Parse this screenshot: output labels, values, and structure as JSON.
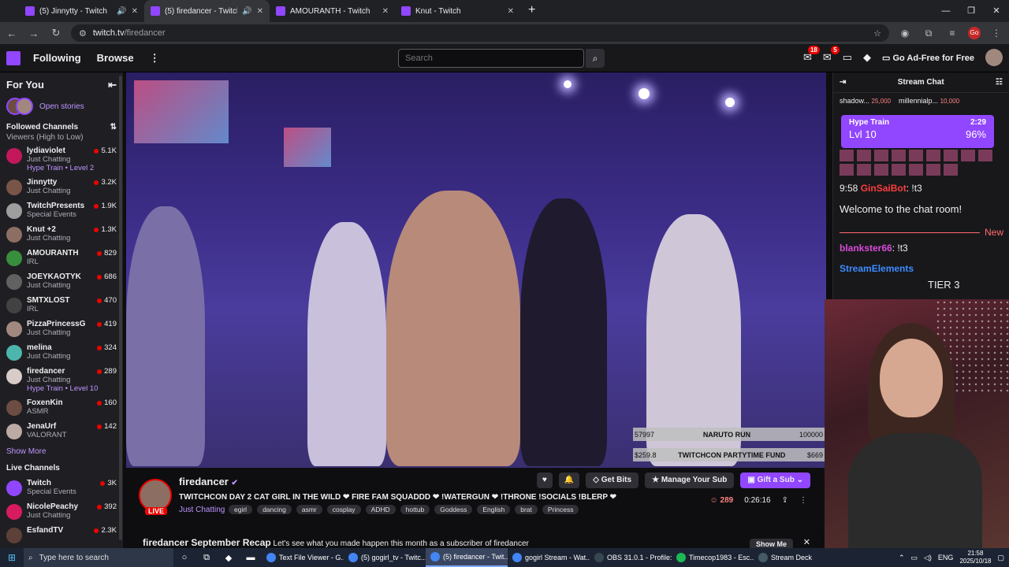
{
  "browser": {
    "tabs": [
      {
        "label": "(5) Jinnytty - Twitch",
        "active": false,
        "audio": true
      },
      {
        "label": "(5) firedancer - Twitch",
        "active": true,
        "audio": true
      },
      {
        "label": "AMOURANTH - Twitch",
        "active": false,
        "audio": false
      },
      {
        "label": "Knut - Twitch",
        "active": false,
        "audio": false
      }
    ],
    "url_host": "twitch.tv",
    "url_path": "/firedancer",
    "profile_initials": "Go"
  },
  "topbar": {
    "following": "Following",
    "browse": "Browse",
    "search_placeholder": "Search",
    "inbox_count": "18",
    "whispers_count": "5",
    "ad_free": "Go Ad-Free for Free"
  },
  "sidebar": {
    "for_you": "For You",
    "open_stories": "Open stories",
    "followed_title": "Followed Channels",
    "followed_sort": "Viewers (High to Low)",
    "channels": [
      {
        "name": "lydiaviolet",
        "category": "Just Chatting",
        "viewers": "5.1K",
        "hype": "Hype Train • Level 2",
        "color": "#c2185b"
      },
      {
        "name": "Jinnytty",
        "category": "Just Chatting",
        "viewers": "3.2K",
        "hype": "",
        "color": "#795548"
      },
      {
        "name": "TwitchPresents",
        "category": "Special Events",
        "viewers": "1.9K",
        "hype": "",
        "color": "#9e9e9e"
      },
      {
        "name": "Knut +2",
        "category": "Just Chatting",
        "viewers": "1.3K",
        "hype": "",
        "color": "#8d6e63"
      },
      {
        "name": "AMOURANTH",
        "category": "IRL",
        "viewers": "829",
        "hype": "",
        "color": "#388e3c"
      },
      {
        "name": "JOEYKAOTYK",
        "category": "Just Chatting",
        "viewers": "686",
        "hype": "",
        "color": "#616161"
      },
      {
        "name": "SMTXLOST",
        "category": "IRL",
        "viewers": "470",
        "hype": "",
        "color": "#424242"
      },
      {
        "name": "PizzaPrincessG",
        "category": "Just Chatting",
        "viewers": "419",
        "hype": "",
        "color": "#a1887f"
      },
      {
        "name": "melina",
        "category": "Just Chatting",
        "viewers": "324",
        "hype": "",
        "color": "#4db6ac"
      },
      {
        "name": "firedancer",
        "category": "Just Chatting",
        "viewers": "289",
        "hype": "Hype Train • Level 10",
        "color": "#d7ccc8"
      },
      {
        "name": "FoxenKin",
        "category": "ASMR",
        "viewers": "160",
        "hype": "",
        "color": "#6d4c41"
      },
      {
        "name": "JenaUrf",
        "category": "VALORANT",
        "viewers": "142",
        "hype": "",
        "color": "#bcaaa4"
      }
    ],
    "show_more": "Show More",
    "live_title": "Live Channels",
    "live_channels": [
      {
        "name": "Twitch",
        "category": "Special Events",
        "viewers": "3K",
        "color": "#9146ff"
      },
      {
        "name": "NicolePeachy",
        "category": "Just Chatting",
        "viewers": "392",
        "color": "#d81b60"
      },
      {
        "name": "EsfandTV",
        "category": "",
        "viewers": "2.3K",
        "color": "#5d4037"
      }
    ]
  },
  "video": {
    "goal1_left": "57997",
    "goal1_mid": "NARUTO RUN",
    "goal1_right": "100000",
    "goal2_left": "$259.8",
    "goal2_mid": "TWITCHCON PARTYTIME FUND",
    "goal2_right": "$669"
  },
  "stream": {
    "name": "firedancer",
    "live": "LIVE",
    "title": "TWITCHCON DAY 2 CAT GIRL IN THE WILD ❤ FIRE FAM SQUADDD ❤ !WATERGUN ❤ !THRONE !SOCIALS !BLERP ❤",
    "category": "Just Chatting",
    "tags": [
      "egirl",
      "dancing",
      "asmr",
      "cosplay",
      "ADHD",
      "hottub",
      "Goddess",
      "English",
      "brat",
      "Princess"
    ],
    "get_bits": "Get Bits",
    "manage_sub": "Manage Your Sub",
    "gift_sub": "Gift a Sub",
    "viewers": "289",
    "uptime": "0:26:16",
    "recap_title": "firedancer September Recap",
    "recap_text": "Let's see what you made happen this month as a subscriber of firedancer",
    "show_me": "Show Me"
  },
  "chat": {
    "title": "Stream Chat",
    "pinned": [
      {
        "user": "shadow...",
        "amount": "25,000"
      },
      {
        "user": "millennialp...",
        "amount": "10,000"
      }
    ],
    "hype_label": "Hype Train",
    "hype_time": "2:29",
    "hype_level": "Lvl 10",
    "hype_pct": "96%",
    "msg1_time": "9:58",
    "msg1_user": "GinSaiBot",
    "msg1_text": ": !t3",
    "welcome": "Welcome to the chat room!",
    "new_label": "New",
    "msg2_user": "blankster66",
    "msg2_text": ": !t3",
    "msg3_user": "StreamElements",
    "msg3_text": "TIER 3"
  },
  "taskbar": {
    "search_placeholder": "Type here to search",
    "apps": [
      {
        "label": "Text File Viewer - G...",
        "active": false,
        "color": "#4285f4"
      },
      {
        "label": "(5) gogirl_tv - Twitc...",
        "active": false,
        "color": "#4285f4"
      },
      {
        "label": "(5) firedancer - Twit...",
        "active": true,
        "color": "#4285f4"
      },
      {
        "label": "gogirl Stream - Wat...",
        "active": false,
        "color": "#4285f4"
      },
      {
        "label": "OBS 31.0.1 - Profile:...",
        "active": false,
        "color": "#37474f"
      },
      {
        "label": "Timecop1983 - Esc...",
        "active": false,
        "color": "#1db954"
      },
      {
        "label": "Stream Deck",
        "active": false,
        "color": "#455a64"
      }
    ],
    "lang": "ENG",
    "time": "21:58",
    "date": "2025/10/18"
  }
}
